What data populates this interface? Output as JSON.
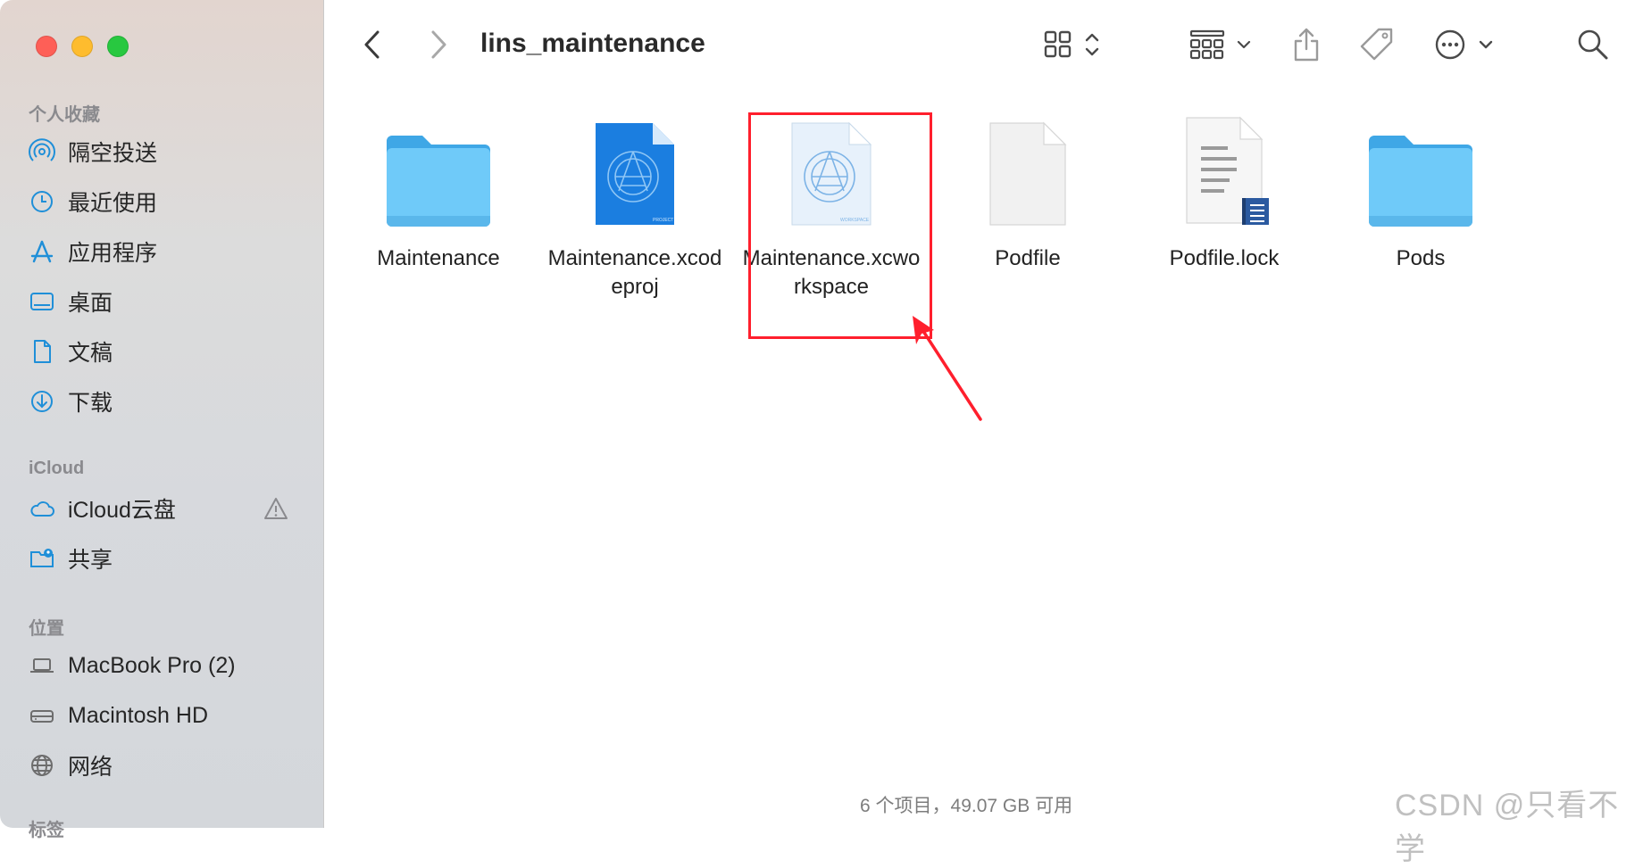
{
  "window": {
    "title": "lins_maintenance"
  },
  "sidebar": {
    "favorites_title": "个人收藏",
    "favorites": [
      {
        "label": "隔空投送",
        "icon": "airdrop-icon"
      },
      {
        "label": "最近使用",
        "icon": "clock-icon"
      },
      {
        "label": "应用程序",
        "icon": "applications-icon"
      },
      {
        "label": "桌面",
        "icon": "desktop-icon"
      },
      {
        "label": "文稿",
        "icon": "document-icon"
      },
      {
        "label": "下载",
        "icon": "download-icon"
      }
    ],
    "icloud_title": "iCloud",
    "icloud": [
      {
        "label": "iCloud云盘",
        "icon": "cloud-icon"
      },
      {
        "label": "共享",
        "icon": "shared-folder-icon"
      }
    ],
    "locations_title": "位置",
    "locations": [
      {
        "label": "MacBook Pro (2)",
        "icon": "laptop-icon"
      },
      {
        "label": "Macintosh HD",
        "icon": "disk-icon"
      },
      {
        "label": "网络",
        "icon": "globe-icon"
      }
    ],
    "tags_title": "标签"
  },
  "toolbar": {
    "back": "back-icon",
    "forward": "forward-icon",
    "view": "grid-view-icon",
    "group": "group-icon",
    "share": "share-icon",
    "tag": "tag-icon",
    "more": "more-icon",
    "search": "search-icon"
  },
  "files": [
    {
      "name": "Maintenance",
      "type": "folder"
    },
    {
      "name": "Maintenance.xcodeproj",
      "type": "xcodeproj"
    },
    {
      "name": "Maintenance.xcworkspace",
      "type": "xcworkspace"
    },
    {
      "name": "Podfile",
      "type": "blank"
    },
    {
      "name": "Podfile.lock",
      "type": "text"
    },
    {
      "name": "Pods",
      "type": "folder"
    }
  ],
  "status": {
    "text": "6 个项目，49.07 GB 可用"
  },
  "watermark": "CSDN @只看不学",
  "colors": {
    "accent": "#1f8fd8",
    "highlight": "#ff1f2d",
    "folder": "#5ec2f7"
  }
}
